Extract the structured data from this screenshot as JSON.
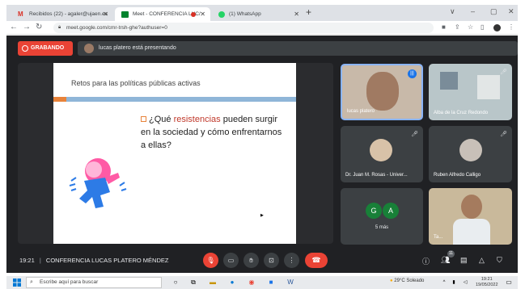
{
  "browser": {
    "tabs": [
      {
        "label": "Recibidos (22) - agaler@ujaen.es",
        "active": false
      },
      {
        "label": "Meet - CONFERENCIA LUC/",
        "active": true,
        "recording": true
      },
      {
        "label": "(1) WhatsApp",
        "active": false
      }
    ],
    "url": "meet.google.com/cmr-trsh-ghe?authuser=0",
    "window_controls": [
      "∨",
      "–",
      "▢",
      "✕"
    ]
  },
  "meet": {
    "recording_label": "GRABANDO",
    "presenting_text": "lucas platero está presentando",
    "slide": {
      "title": "Retos para las políticas públicas activas",
      "question_before": "¿Qué ",
      "question_highlight": "resistencias",
      "question_after": " pueden surgir en la sociedad y cómo enfrentarnos a ellas?"
    },
    "participants": [
      {
        "name": "lucas platero",
        "speaking": true
      },
      {
        "name": "Alba de la Cruz Redondo",
        "muted": true
      },
      {
        "name": "Dr. Juan M. Rosas - Univer...",
        "muted": true
      },
      {
        "name": "Ruben Alfredo Calligo",
        "muted": true
      },
      {
        "name": "",
        "initials": [
          "G",
          "A"
        ],
        "more_label": "5 más"
      },
      {
        "name": "Ta...",
        "muted": false
      }
    ],
    "bottom": {
      "time": "19:21",
      "meeting_title": "CONFERENCIA LUCAS PLATERO MÉNDEZ",
      "participant_count": "11"
    },
    "colors": {
      "recording": "#ea4335",
      "background": "#202124",
      "tile": "#3c4043",
      "speaking": "#1a73e8"
    }
  },
  "taskbar": {
    "search_placeholder": "Escribe aquí para buscar",
    "weather": "29°C Soleado",
    "clock_time": "19:21",
    "clock_date": "19/05/2022"
  }
}
